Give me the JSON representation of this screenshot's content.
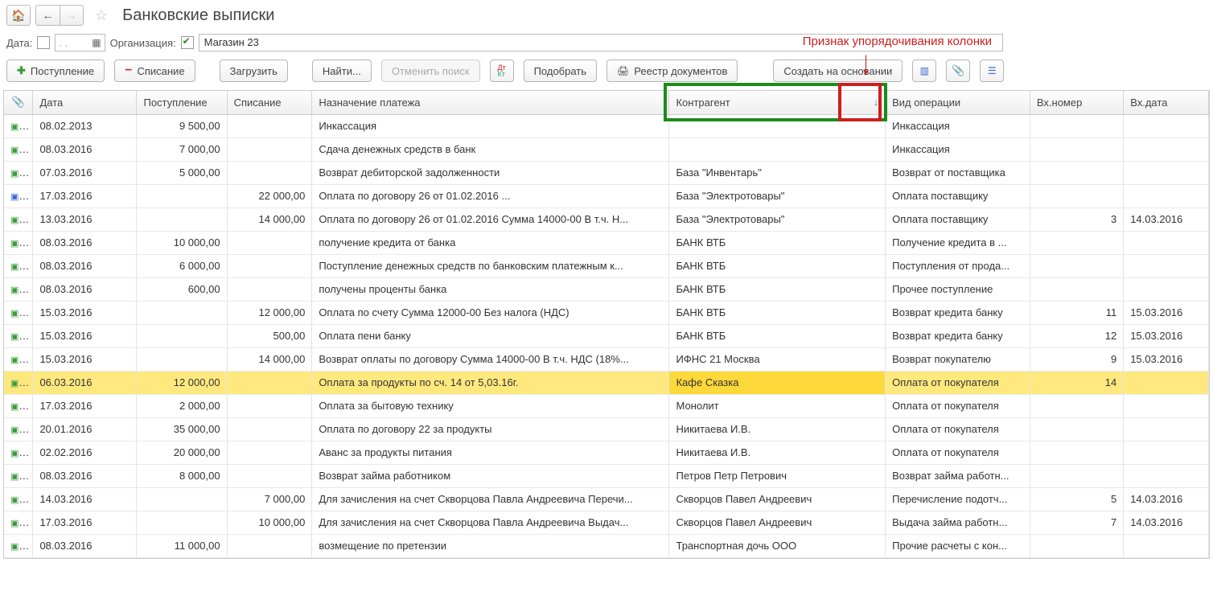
{
  "title": "Банковские выписки",
  "annotation": "Признак упорядочивания колонки",
  "filters": {
    "date_label": "Дата:",
    "date_placeholder": ".    .",
    "org_label": "Организация:",
    "org_value": "Магазин 23"
  },
  "toolbar": {
    "inflow": "Поступление",
    "outflow": "Списание",
    "load": "Загрузить",
    "find": "Найти...",
    "cancel_search": "Отменить поиск",
    "select": "Подобрать",
    "registry": "Реестр документов",
    "create_based": "Создать на основании"
  },
  "columns": {
    "date": "Дата",
    "inflow": "Поступление",
    "outflow": "Списание",
    "purpose": "Назначение платежа",
    "agent": "Контрагент",
    "sort_arrow": "↓",
    "type": "Вид операции",
    "in_num": "Вх.номер",
    "in_date": "Вх.дата"
  },
  "rows": [
    {
      "icon": "green",
      "date": "08.02.2013",
      "in": "9 500,00",
      "out": "",
      "purpose": "Инкассация",
      "agent": "",
      "type": "Инкассация",
      "num": "",
      "idate": ""
    },
    {
      "icon": "green",
      "date": "08.03.2016",
      "in": "7 000,00",
      "out": "",
      "purpose": "Сдача денежных средств в банк",
      "agent": "",
      "type": "Инкассация",
      "num": "",
      "idate": ""
    },
    {
      "icon": "green",
      "date": "07.03.2016",
      "in": "5 000,00",
      "out": "",
      "purpose": "Возврат дебиторской задолженности",
      "agent": "База \"Инвентарь\"",
      "type": "Возврат от поставщика",
      "num": "",
      "idate": ""
    },
    {
      "icon": "blue",
      "date": "17.03.2016",
      "in": "",
      "out": "22 000,00",
      "purpose": "Оплата по договору 26 от 01.02.2016 ...",
      "agent": "База \"Электротовары\"",
      "type": "Оплата поставщику",
      "num": "",
      "idate": ""
    },
    {
      "icon": "green",
      "date": "13.03.2016",
      "in": "",
      "out": "14 000,00",
      "purpose": "Оплата по договору 26 от 01.02.2016 Сумма 14000-00 В т.ч. Н...",
      "agent": "База \"Электротовары\"",
      "type": "Оплата поставщику",
      "num": "3",
      "idate": "14.03.2016"
    },
    {
      "icon": "green",
      "date": "08.03.2016",
      "in": "10 000,00",
      "out": "",
      "purpose": "получение кредита от банка",
      "agent": "БАНК ВТБ",
      "type": "Получение кредита в ...",
      "num": "",
      "idate": ""
    },
    {
      "icon": "green",
      "date": "08.03.2016",
      "in": "6 000,00",
      "out": "",
      "purpose": "Поступление денежных средств по банковским платежным к...",
      "agent": "БАНК ВТБ",
      "type": "Поступления от прода...",
      "num": "",
      "idate": ""
    },
    {
      "icon": "green",
      "date": "08.03.2016",
      "in": "600,00",
      "out": "",
      "purpose": "получены проценты банка",
      "agent": "БАНК ВТБ",
      "type": "Прочее поступление",
      "num": "",
      "idate": ""
    },
    {
      "icon": "green",
      "date": "15.03.2016",
      "in": "",
      "out": "12 000,00",
      "purpose": "Оплата по счету Сумма 12000-00 Без налога (НДС)",
      "agent": "БАНК ВТБ",
      "type": "Возврат кредита банку",
      "num": "11",
      "idate": "15.03.2016"
    },
    {
      "icon": "green",
      "date": "15.03.2016",
      "in": "",
      "out": "500,00",
      "purpose": "Оплата пени банку",
      "agent": "БАНК ВТБ",
      "type": "Возврат кредита банку",
      "num": "12",
      "idate": "15.03.2016"
    },
    {
      "icon": "green",
      "date": "15.03.2016",
      "in": "",
      "out": "14 000,00",
      "purpose": "Возврат оплаты по договору Сумма 14000-00 В т.ч. НДС  (18%...",
      "agent": "ИФНС 21 Москва",
      "type": "Возврат покупателю",
      "num": "9",
      "idate": "15.03.2016"
    },
    {
      "icon": "green",
      "date": "06.03.2016",
      "in": "12 000,00",
      "out": "",
      "purpose": "Оплата за продукты по сч. 14 от 5,03.16г.",
      "agent": "Кафе Сказка",
      "type": "Оплата от покупателя",
      "num": "14",
      "idate": "",
      "selected": true
    },
    {
      "icon": "green",
      "date": "17.03.2016",
      "in": "2 000,00",
      "out": "",
      "purpose": "Оплата за бытовую технику",
      "agent": "Монолит",
      "type": "Оплата от покупателя",
      "num": "",
      "idate": ""
    },
    {
      "icon": "green",
      "date": "20.01.2016",
      "in": "35 000,00",
      "out": "",
      "purpose": "Оплата по договору 22 за продукты",
      "agent": "Никитаева И.В.",
      "type": "Оплата от покупателя",
      "num": "",
      "idate": ""
    },
    {
      "icon": "green",
      "date": "02.02.2016",
      "in": "20 000,00",
      "out": "",
      "purpose": "Аванс за продукты питания",
      "agent": "Никитаева И.В.",
      "type": "Оплата от покупателя",
      "num": "",
      "idate": ""
    },
    {
      "icon": "green",
      "date": "08.03.2016",
      "in": "8 000,00",
      "out": "",
      "purpose": "Возврат займа работником",
      "agent": "Петров Петр Петрович",
      "type": "Возврат займа работн...",
      "num": "",
      "idate": ""
    },
    {
      "icon": "green",
      "date": "14.03.2016",
      "in": "",
      "out": "7 000,00",
      "purpose": "Для зачисления на счет Скворцова Павла Андреевича Перечи...",
      "agent": "Скворцов Павел Андреевич",
      "type": "Перечисление подотч...",
      "num": "5",
      "idate": "14.03.2016"
    },
    {
      "icon": "green",
      "date": "17.03.2016",
      "in": "",
      "out": "10 000,00",
      "purpose": "Для зачисления на счет Скворцова Павла Андреевича Выдач...",
      "agent": "Скворцов Павел Андреевич",
      "type": "Выдача займа работн...",
      "num": "7",
      "idate": "14.03.2016"
    },
    {
      "icon": "green",
      "date": "08.03.2016",
      "in": "11 000,00",
      "out": "",
      "purpose": "возмещение по претензии",
      "agent": "Транспортная дочь ООО",
      "type": "Прочие расчеты с кон...",
      "num": "",
      "idate": ""
    }
  ]
}
